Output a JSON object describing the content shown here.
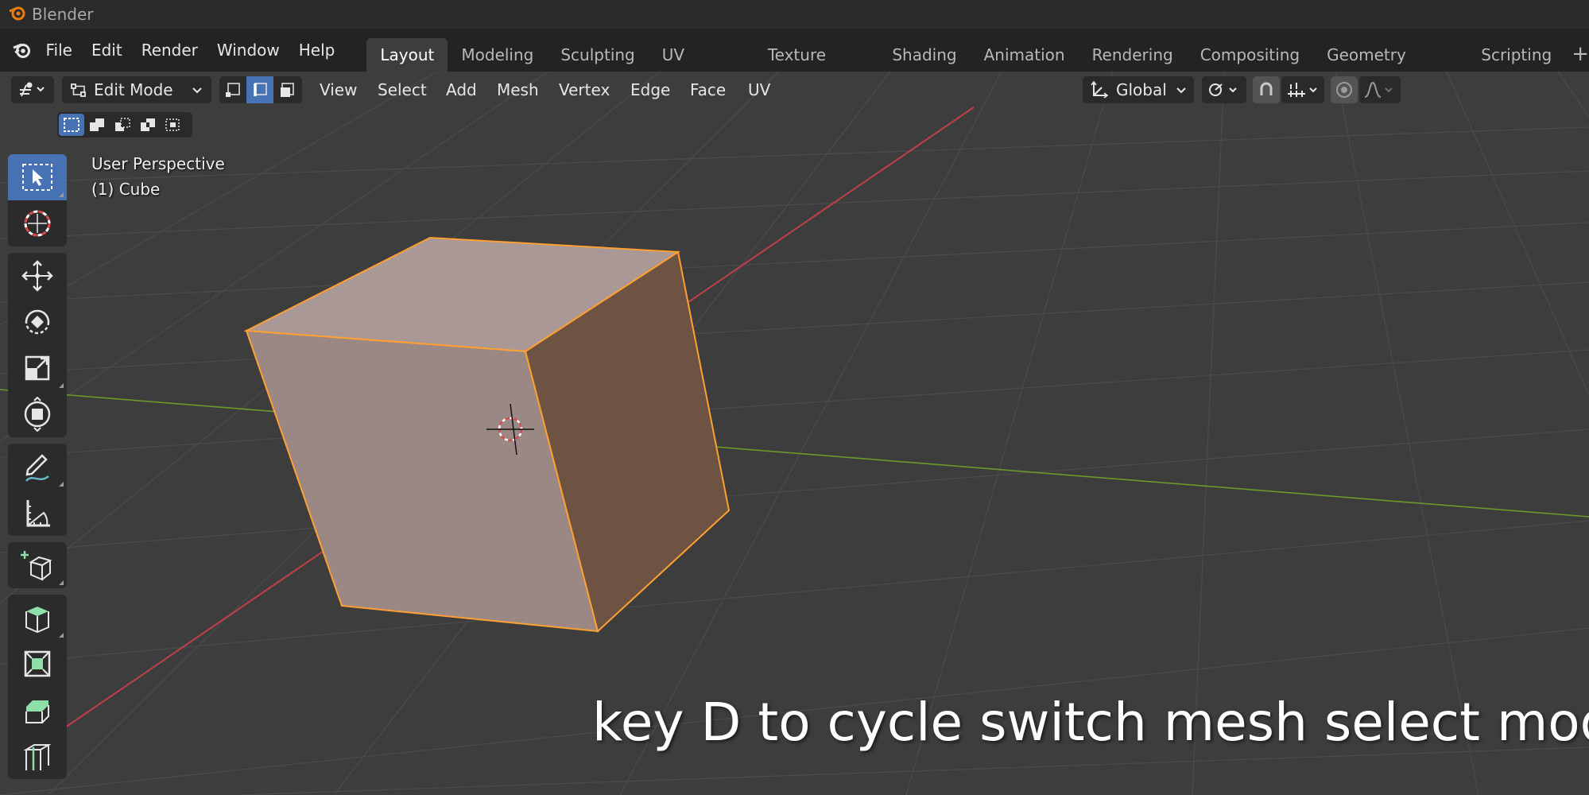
{
  "titlebar": {
    "title": "Blender"
  },
  "menubar": {
    "items": [
      "File",
      "Edit",
      "Render",
      "Window",
      "Help"
    ],
    "workspaces": [
      "Layout",
      "Modeling",
      "Sculpting",
      "UV Editing",
      "Texture Paint",
      "Shading",
      "Animation",
      "Rendering",
      "Compositing",
      "Geometry Nodes",
      "Scripting"
    ],
    "active_workspace": "Layout",
    "add_label": "+"
  },
  "header": {
    "mode": "Edit Mode",
    "menus": [
      "View",
      "Select",
      "Add",
      "Mesh",
      "Vertex",
      "Edge",
      "Face",
      "UV"
    ],
    "orientation": "Global",
    "select_mode_active": "edge"
  },
  "viewport": {
    "perspective_label": "User Perspective",
    "object_label": "(1) Cube"
  },
  "caption": "key D to cycle switch mesh select mode",
  "colors": {
    "accent": "#4772b3",
    "selection_outline": "#ffa032",
    "x_axis": "#c0404a",
    "y_axis": "#6a9a2a"
  },
  "toolbar": {
    "tools": [
      "select-box-icon",
      "cursor-icon",
      "move-icon",
      "rotate-icon",
      "scale-icon",
      "transform-icon",
      "annotate-icon",
      "measure-icon",
      "add-cube-icon",
      "extrude-icon",
      "inset-icon",
      "bevel-icon",
      "loop-cut-icon"
    ]
  }
}
